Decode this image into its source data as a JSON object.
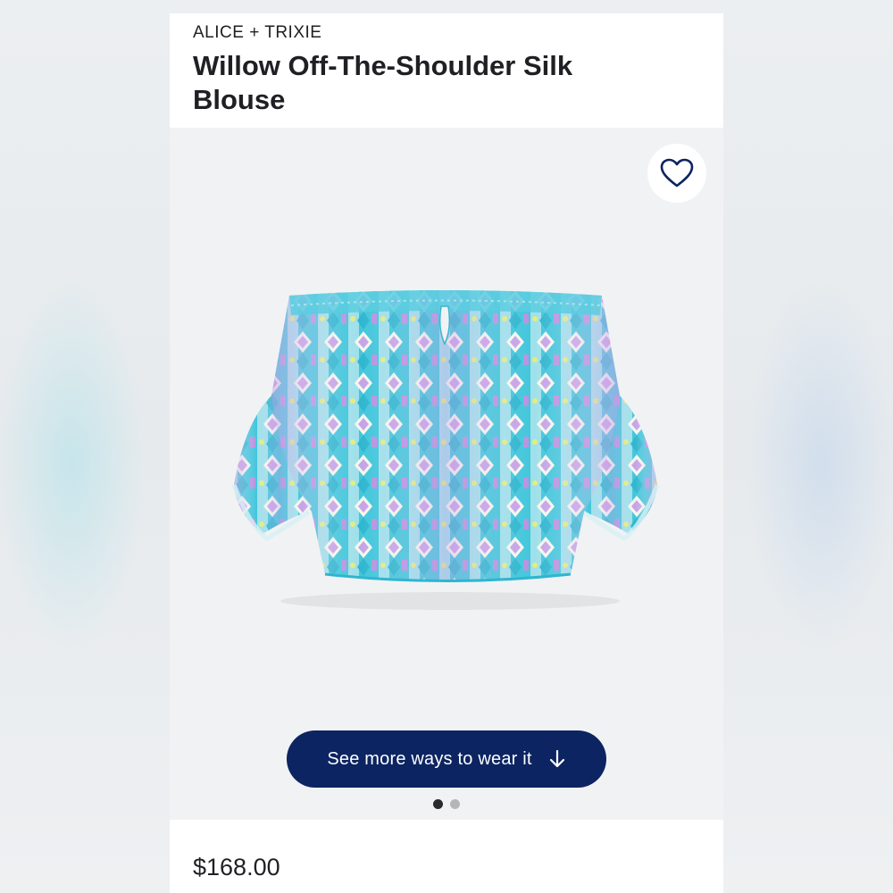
{
  "product": {
    "brand": "ALICE + TRIXIE",
    "title": "Willow Off-The-Shoulder Silk Blouse",
    "price": "$168.00"
  },
  "actions": {
    "favorite_icon": "heart-outline-icon",
    "see_more_label": "See more ways to wear it",
    "see_more_icon": "arrow-down-icon"
  },
  "carousel": {
    "total": 2,
    "active": 1
  },
  "colors": {
    "cta_background": "#0c2461",
    "heart_stroke": "#0c2461",
    "dot_active": "#2b2b2b",
    "dot_inactive": "#b6b6b6",
    "print_turquoise": "#35c3d9",
    "print_lavender": "#c7a3e6",
    "print_yellow": "#e3ee7a"
  }
}
